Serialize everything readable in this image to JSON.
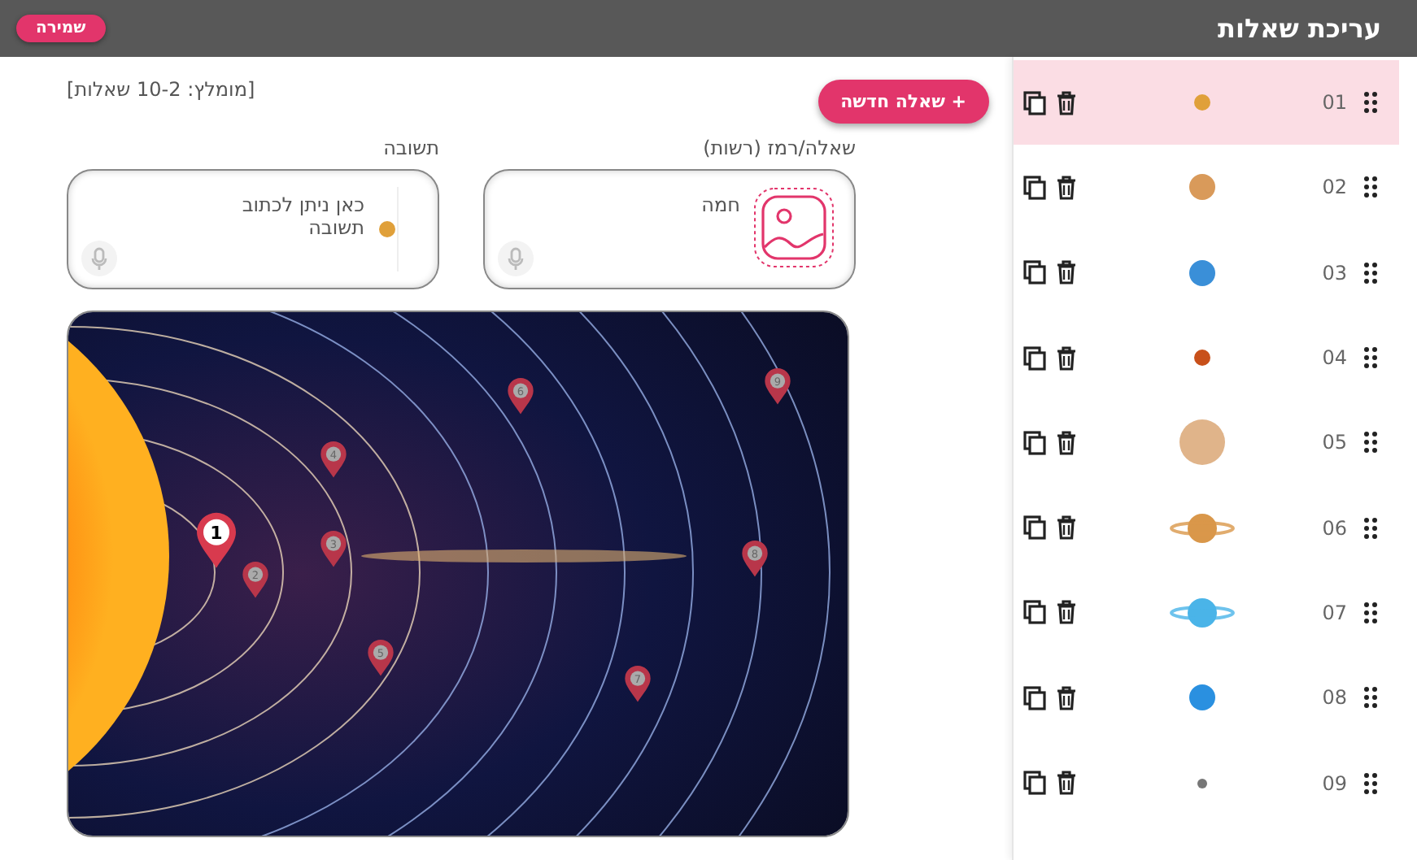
{
  "header": {
    "title": "עריכת שאלות",
    "save_button": "שמירה"
  },
  "questions": [
    {
      "number": "01",
      "selected": true,
      "kind": "small",
      "color": "#e0a03a"
    },
    {
      "number": "02",
      "selected": false,
      "kind": "medium",
      "color": "#d99a5a"
    },
    {
      "number": "03",
      "selected": false,
      "kind": "medium",
      "color": "#3a8fd8"
    },
    {
      "number": "04",
      "selected": false,
      "kind": "small",
      "color": "#c8501a"
    },
    {
      "number": "05",
      "selected": false,
      "kind": "large",
      "color": "#e0b48a"
    },
    {
      "number": "06",
      "selected": false,
      "kind": "ringed",
      "color": "#d9974a"
    },
    {
      "number": "07",
      "selected": false,
      "kind": "ringed",
      "color": "#4ab4e8"
    },
    {
      "number": "08",
      "selected": false,
      "kind": "medium",
      "color": "#2a90e0"
    },
    {
      "number": "09",
      "selected": false,
      "kind": "tiny",
      "color": "#777777"
    }
  ],
  "new_question_button": "+ שאלה חדשה",
  "recommendation": "[מומלץ: 10-2 שאלות]",
  "question_field": {
    "label": "שאלה/רמז (רשות)",
    "value": "חמה"
  },
  "answer_field": {
    "label": "תשובה",
    "placeholder": "כאן ניתן לכתוב תשובה"
  },
  "pins": [
    {
      "label": "1",
      "selected": true
    },
    {
      "label": "2",
      "selected": false
    },
    {
      "label": "3",
      "selected": false
    },
    {
      "label": "4",
      "selected": false
    },
    {
      "label": "5",
      "selected": false
    },
    {
      "label": "6",
      "selected": false
    },
    {
      "label": "7",
      "selected": false
    },
    {
      "label": "8",
      "selected": false
    },
    {
      "label": "9",
      "selected": false
    }
  ]
}
